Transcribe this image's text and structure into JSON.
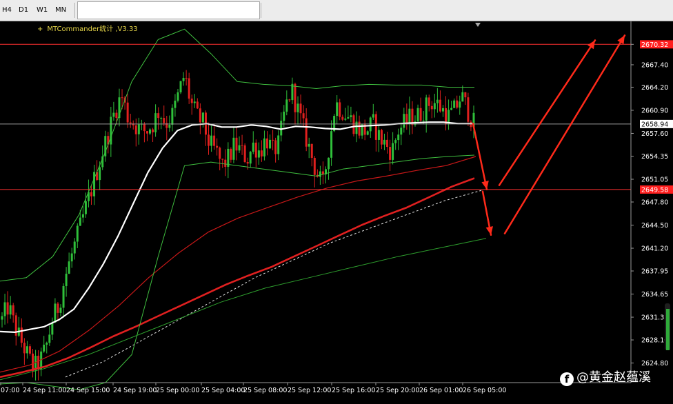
{
  "toolbar": {
    "timeframes": [
      "H4",
      "D1",
      "W1",
      "MN"
    ]
  },
  "indicator_label": "MTCommander统计 ,V3.33",
  "watermark": {
    "text": "@黄金赵蕴溪",
    "icon": "facebook-icon"
  },
  "colors": {
    "background": "#000000",
    "bull": "#2fbf3a",
    "bear": "#e0201e",
    "ma_white": "#ffffff",
    "ma_red": "#e02020",
    "bollinger": "#3fbf3f",
    "arrow": "#ff2a1a",
    "level_line": "#ff3030",
    "axis_text": "#ffffff"
  },
  "chart_data": {
    "type": "candlestick",
    "title": "",
    "ylim": [
      2622.0,
      2673.6
    ],
    "y_ticks": [
      "2670.32",
      "2667.40",
      "2664.20",
      "2660.90",
      "2657.60",
      "2654.35",
      "2651.05",
      "2647.80",
      "2644.50",
      "2641.20",
      "2637.95",
      "2634.65",
      "2631.35",
      "2628.10",
      "2624.80"
    ],
    "price_labels": [
      {
        "value": "2670.32",
        "style": "level"
      },
      {
        "value": "2658.94",
        "style": "current"
      },
      {
        "value": "2649.58",
        "style": "level"
      }
    ],
    "x_labels": [
      "07:00",
      "24 Sep 11:00",
      "24 Sep 15:00",
      "24 Sep 19:00",
      "25 Sep 00:00",
      "25 Sep 04:00",
      "25 Sep 08:00",
      "25 Sep 12:00",
      "25 Sep 16:00",
      "25 Sep 20:00",
      "26 Sep 01:00",
      "26 Sep 05:00"
    ],
    "horizontal_levels": [
      2670.32,
      2658.94,
      2649.58
    ],
    "candles_anchor_closes": [
      2631,
      2633,
      2630,
      2628,
      2626,
      2624,
      2625,
      2627,
      2631,
      2633,
      2637,
      2640,
      2643,
      2646,
      2649,
      2652,
      2655,
      2658,
      2661,
      2663,
      2660,
      2659,
      2658,
      2658,
      2659,
      2661,
      2659,
      2660,
      2663,
      2666,
      2662,
      2660,
      2659,
      2656,
      2655,
      2653,
      2654,
      2656,
      2655,
      2654,
      2656,
      2655,
      2657,
      2655,
      2656,
      2661,
      2664,
      2661,
      2658,
      2655,
      2652,
      2650,
      2656,
      2662,
      2661,
      2660,
      2659,
      2658,
      2658,
      2659,
      2657,
      2656,
      2655,
      2658,
      2659,
      2660,
      2660,
      2661,
      2662,
      2662,
      2661,
      2660,
      2661,
      2663,
      2661,
      2659
    ],
    "series": [
      {
        "name": "",
        "kind": "ma_white",
        "values": [
          2629.3,
          2629.2,
          2629.6,
          2630.0,
          2631.0,
          2632.5,
          2635.5,
          2639.0,
          2643.0,
          2647.5,
          2652.0,
          2655.5,
          2658.0,
          2658.8,
          2659.0,
          2658.5,
          2658.5,
          2658.8,
          2658.6,
          2658.2,
          2658.6,
          2658.5,
          2658.3,
          2658.2,
          2658.6,
          2658.7,
          2658.8,
          2659.0,
          2659.1,
          2659.2,
          2659.2,
          2659.0,
          2659.0
        ]
      },
      {
        "name": "",
        "kind": "ma_red_thick",
        "values": [
          2622.8,
          2623.5,
          2624.3,
          2625.5,
          2627.0,
          2628.6,
          2630.0,
          2631.5,
          2633.0,
          2634.5,
          2636.0,
          2637.3,
          2638.5,
          2640.0,
          2641.5,
          2643.0,
          2644.5,
          2645.8,
          2647.0,
          2648.5,
          2650.0,
          2651.2
        ]
      },
      {
        "name": "",
        "kind": "ma_red_thin",
        "values": [
          2623.5,
          2624.5,
          2626.5,
          2629.5,
          2633.0,
          2637.0,
          2640.5,
          2643.5,
          2645.5,
          2647.0,
          2648.5,
          2649.8,
          2650.8,
          2651.5,
          2652.3,
          2653.0,
          2654.3
        ]
      },
      {
        "name": "",
        "kind": "dotted",
        "values": [
          2622.8,
          2625.0,
          2628.0,
          2631.0,
          2634.0,
          2637.0,
          2639.5,
          2642.0,
          2644.0,
          2646.0,
          2648.0,
          2649.5
        ]
      },
      {
        "name": "",
        "kind": "bollinger_upper",
        "values": [
          2636.5,
          2637.0,
          2640.0,
          2646.0,
          2655.0,
          2665.0,
          2671.0,
          2672.5,
          2669.0,
          2665.0,
          2664.6,
          2664.4,
          2664.0,
          2664.4,
          2664.6,
          2664.5,
          2664.5,
          2664.2,
          2664.2
        ]
      },
      {
        "name": "",
        "kind": "bollinger_lower",
        "values": [
          2621.8,
          2622.0,
          2621.5,
          2621.0,
          2622.0,
          2626.0,
          2640.0,
          2653.0,
          2653.5,
          2653.0,
          2652.5,
          2652.0,
          2651.5,
          2652.5,
          2653.0,
          2653.5,
          2654.0,
          2654.3,
          2654.5
        ]
      },
      {
        "name": "",
        "kind": "bollinger_far_lower",
        "values": [
          2622.4,
          2624.0,
          2626.0,
          2628.5,
          2631.0,
          2633.5,
          2635.5,
          2637.0,
          2638.5,
          2640.0,
          2641.3,
          2642.6
        ]
      }
    ],
    "arrows": [
      {
        "from": [
          2659.0,
          "26 Sep 05:00"
        ],
        "to": [
          2649.6,
          "+1 bar"
        ],
        "label": ""
      },
      {
        "from": [
          2649.3,
          "26 Sep 05:00"
        ],
        "to": [
          2643.1,
          "+1 bar"
        ],
        "label": ""
      }
    ],
    "grid": false,
    "legend": "none"
  }
}
